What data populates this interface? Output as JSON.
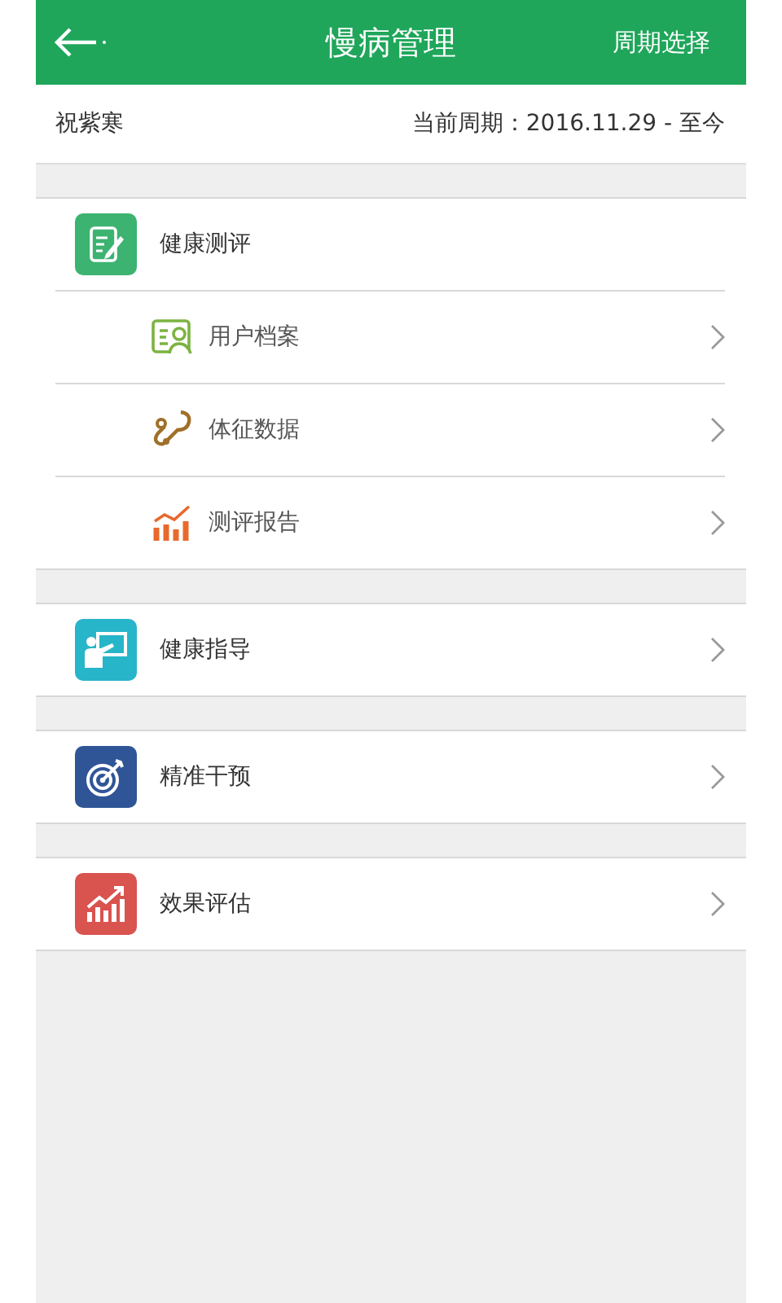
{
  "header": {
    "title": "慢病管理",
    "action": "周期选择"
  },
  "info": {
    "name": "祝紫寒",
    "period": "当前周期：2016.11.29 - 至今"
  },
  "sections": [
    {
      "title": "健康测评",
      "expanded": true,
      "children": [
        {
          "label": "用户档案"
        },
        {
          "label": "体征数据"
        },
        {
          "label": "测评报告"
        }
      ]
    },
    {
      "title": "健康指导",
      "expanded": false
    },
    {
      "title": "精准干预",
      "expanded": false
    },
    {
      "title": "效果评估",
      "expanded": false
    }
  ]
}
